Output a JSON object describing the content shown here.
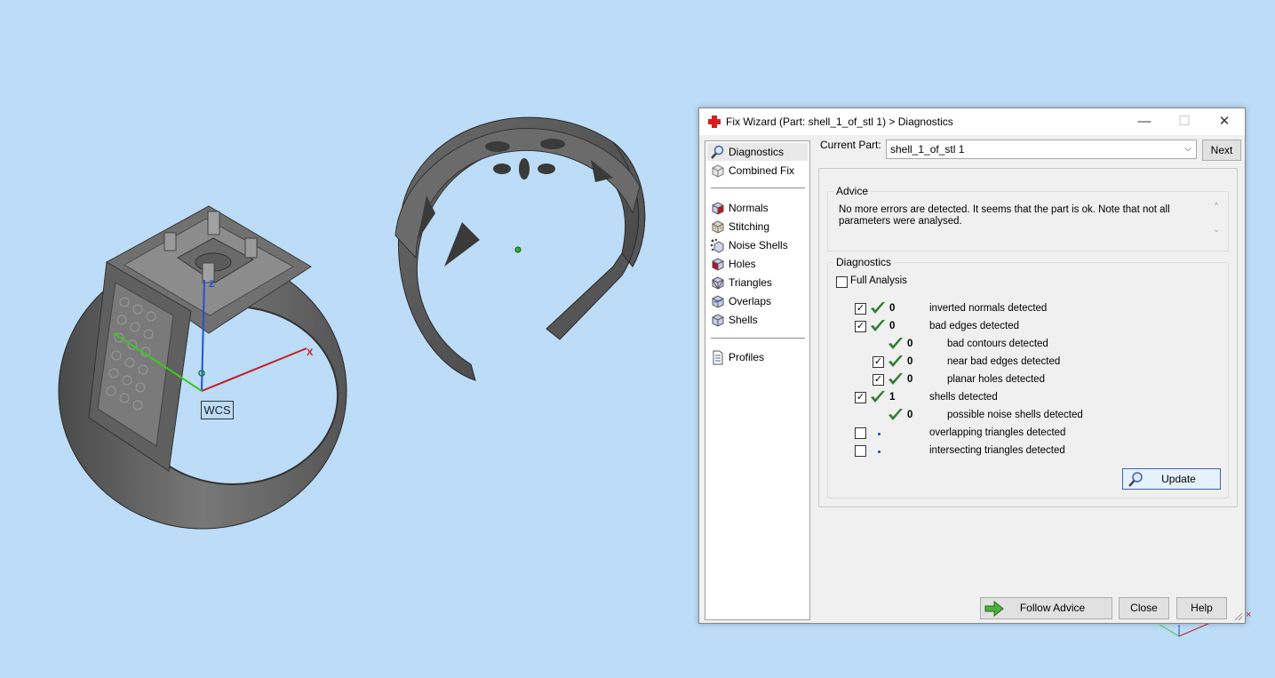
{
  "viewport": {
    "wcs_label": "WCS",
    "axis_x": "X",
    "axis_z": "Z"
  },
  "dialog": {
    "title": "Fix Wizard (Part: shell_1_of_stl 1) > Diagnostics",
    "window_buttons": {
      "minimize": "—",
      "maximize": "☐",
      "close": "✕"
    },
    "nav": {
      "top": [
        {
          "label": "Diagnostics",
          "icon": "magnifier-icon"
        },
        {
          "label": "Combined Fix",
          "icon": "cube-icon"
        }
      ],
      "middle": [
        {
          "label": "Normals",
          "icon": "normals-cube-icon"
        },
        {
          "label": "Stitching",
          "icon": "stitching-cube-icon"
        },
        {
          "label": "Noise Shells",
          "icon": "noise-shells-icon"
        },
        {
          "label": "Holes",
          "icon": "holes-cube-icon"
        },
        {
          "label": "Triangles",
          "icon": "triangles-cube-icon"
        },
        {
          "label": "Overlaps",
          "icon": "overlaps-cube-icon"
        },
        {
          "label": "Shells",
          "icon": "shells-cube-icon"
        }
      ],
      "bottom": [
        {
          "label": "Profiles",
          "icon": "document-icon"
        }
      ]
    },
    "current_part_label": "Current Part:",
    "current_part_value": "shell_1_of_stl 1",
    "next_label": "Next",
    "advice_title": "Advice",
    "advice_text": "No more errors are detected. It seems that the part is ok. Note that not all parameters were analysed.",
    "diagnostics_title": "Diagnostics",
    "full_analysis_label": "Full Analysis",
    "rows": [
      {
        "checked": true,
        "status": "ok",
        "count": "0",
        "text": "inverted normals detected",
        "level": 0
      },
      {
        "checked": true,
        "status": "ok",
        "count": "0",
        "text": "bad edges detected",
        "level": 0
      },
      {
        "checked": null,
        "status": "ok",
        "count": "0",
        "text": "bad contours detected",
        "level": 1
      },
      {
        "checked": true,
        "status": "ok",
        "count": "0",
        "text": "near bad edges detected",
        "level": 1
      },
      {
        "checked": true,
        "status": "ok",
        "count": "0",
        "text": "planar holes detected",
        "level": 1
      },
      {
        "checked": true,
        "status": "ok",
        "count": "1",
        "text": "shells detected",
        "level": 0
      },
      {
        "checked": null,
        "status": "ok",
        "count": "0",
        "text": "possible noise shells detected",
        "level": 1
      },
      {
        "checked": false,
        "status": "dot",
        "count": "",
        "text": "overlapping triangles detected",
        "level": 0
      },
      {
        "checked": false,
        "status": "dot",
        "count": "",
        "text": "intersecting triangles detected",
        "level": 0
      }
    ],
    "update_label": "Update",
    "follow_advice_label": "Follow Advice",
    "close_label": "Close",
    "help_label": "Help"
  },
  "colors": {
    "background": "#bcdcf7",
    "check_green": "#2e7d32",
    "accent_blue": "#3c64b4",
    "axis_x": "#c81e1e",
    "axis_y": "#3cc81e",
    "axis_z": "#2850d2"
  }
}
